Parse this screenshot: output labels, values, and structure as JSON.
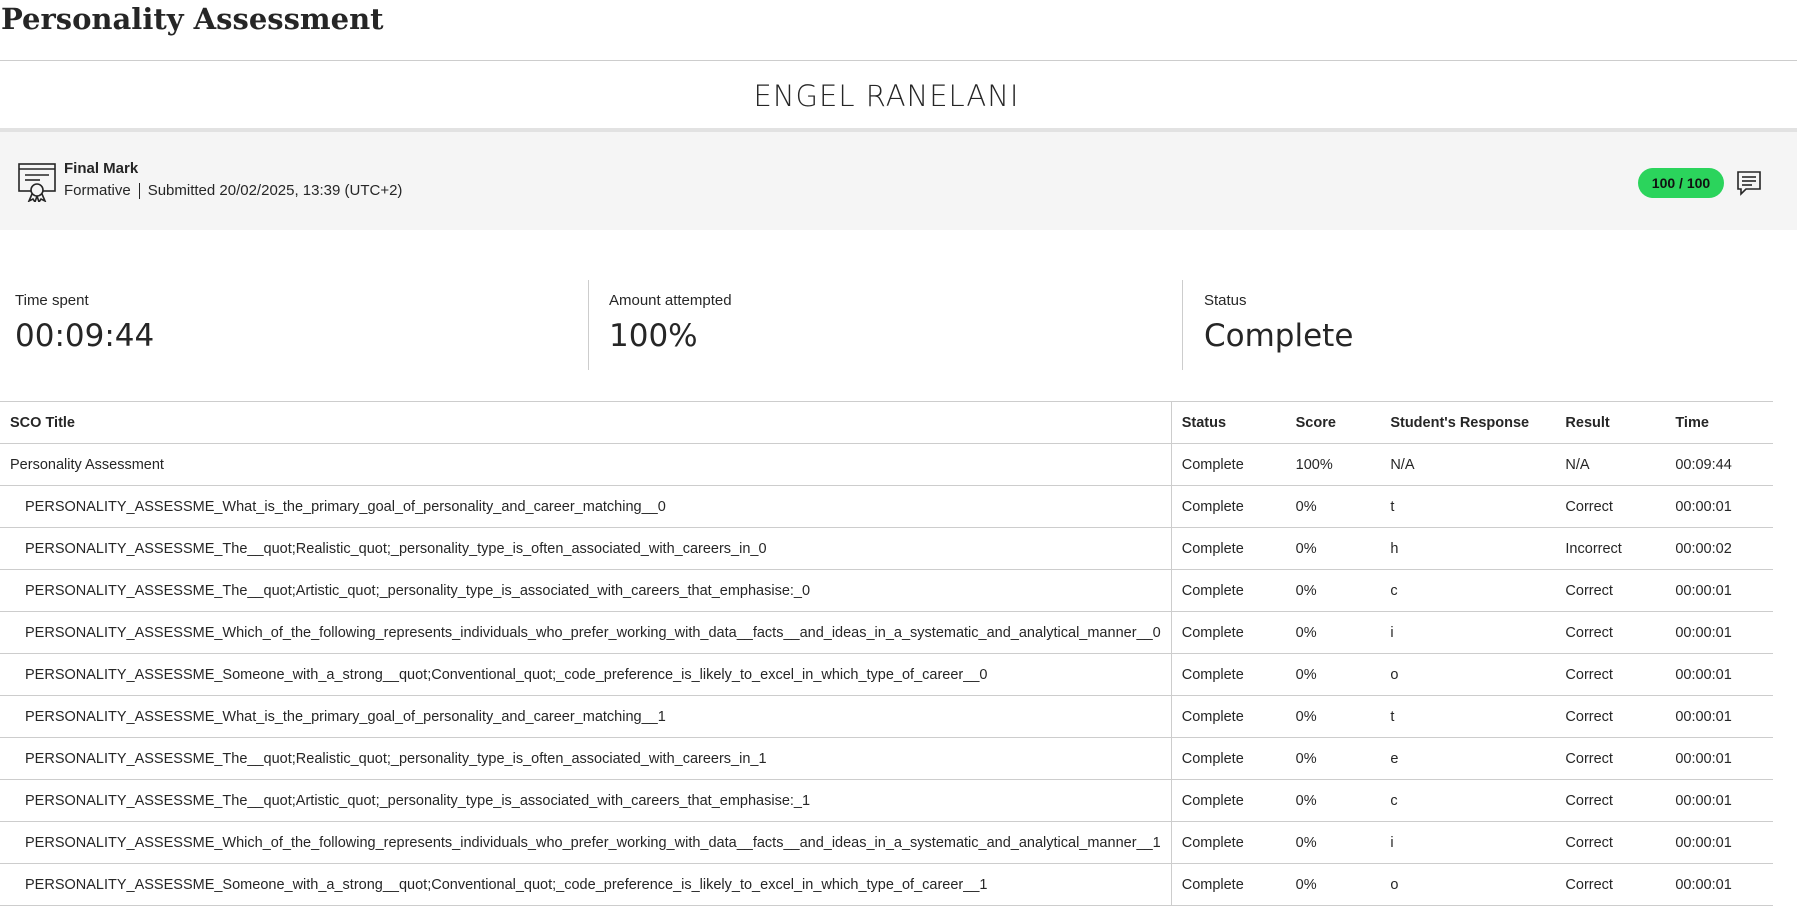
{
  "page": {
    "title": "Personality Assessment"
  },
  "student": {
    "name": "ENGEL RANELANI"
  },
  "final_mark": {
    "title": "Final Mark",
    "type": "Formative",
    "submitted": "Submitted 20/02/2025, 13:39 (UTC+2)",
    "score": "100 / 100",
    "icon": "certificate-icon",
    "feedback_icon": "feedback-comment-icon",
    "score_color": "#2bd45c"
  },
  "stats": {
    "time_spent": {
      "label": "Time spent",
      "value": "00:09:44"
    },
    "amount_attempted": {
      "label": "Amount attempted",
      "value": "100%"
    },
    "status": {
      "label": "Status",
      "value": "Complete"
    }
  },
  "table": {
    "headers": {
      "title": "SCO Title",
      "status": "Status",
      "score": "Score",
      "response": "Student's Response",
      "result": "Result",
      "time": "Time"
    },
    "rows": [
      {
        "title": "Personality Assessment",
        "status": "Complete",
        "score": "100%",
        "response": "N/A",
        "result": "N/A",
        "time": "00:09:44"
      },
      {
        "title": "PERSONALITY_ASSESSME_What_is_the_primary_goal_of_personality_and_career_matching__0",
        "status": "Complete",
        "score": "0%",
        "response": "t",
        "result": "Correct",
        "time": "00:00:01"
      },
      {
        "title": "PERSONALITY_ASSESSME_The__quot;Realistic_quot;_personality_type_is_often_associated_with_careers_in_0",
        "status": "Complete",
        "score": "0%",
        "response": "h",
        "result": "Incorrect",
        "time": "00:00:02"
      },
      {
        "title": "PERSONALITY_ASSESSME_The__quot;Artistic_quot;_personality_type_is_associated_with_careers_that_emphasise:_0",
        "status": "Complete",
        "score": "0%",
        "response": "c",
        "result": "Correct",
        "time": "00:00:01"
      },
      {
        "title": "PERSONALITY_ASSESSME_Which_of_the_following_represents_individuals_who_prefer_working_with_data__facts__and_ideas_in_a_systematic_and_analytical_manner__0",
        "status": "Complete",
        "score": "0%",
        "response": "i",
        "result": "Correct",
        "time": "00:00:01"
      },
      {
        "title": "PERSONALITY_ASSESSME_Someone_with_a_strong__quot;Conventional_quot;_code_preference_is_likely_to_excel_in_which_type_of_career__0",
        "status": "Complete",
        "score": "0%",
        "response": "o",
        "result": "Correct",
        "time": "00:00:01"
      },
      {
        "title": "PERSONALITY_ASSESSME_What_is_the_primary_goal_of_personality_and_career_matching__1",
        "status": "Complete",
        "score": "0%",
        "response": "t",
        "result": "Correct",
        "time": "00:00:01"
      },
      {
        "title": "PERSONALITY_ASSESSME_The__quot;Realistic_quot;_personality_type_is_often_associated_with_careers_in_1",
        "status": "Complete",
        "score": "0%",
        "response": "e",
        "result": "Correct",
        "time": "00:00:01"
      },
      {
        "title": "PERSONALITY_ASSESSME_The__quot;Artistic_quot;_personality_type_is_associated_with_careers_that_emphasise:_1",
        "status": "Complete",
        "score": "0%",
        "response": "c",
        "result": "Correct",
        "time": "00:00:01"
      },
      {
        "title": "PERSONALITY_ASSESSME_Which_of_the_following_represents_individuals_who_prefer_working_with_data__facts__and_ideas_in_a_systematic_and_analytical_manner__1",
        "status": "Complete",
        "score": "0%",
        "response": "i",
        "result": "Correct",
        "time": "00:00:01"
      },
      {
        "title": "PERSONALITY_ASSESSME_Someone_with_a_strong__quot;Conventional_quot;_code_preference_is_likely_to_excel_in_which_type_of_career__1",
        "status": "Complete",
        "score": "0%",
        "response": "o",
        "result": "Correct",
        "time": "00:00:01"
      }
    ]
  }
}
